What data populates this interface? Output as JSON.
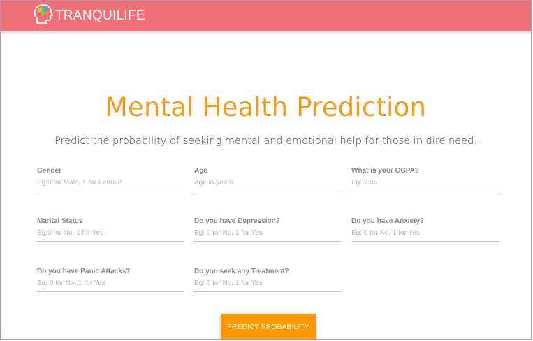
{
  "navbar": {
    "brand_name": "TRANQUILIFE",
    "brand_icon": "brain-head-icon",
    "background_color": "#f07077"
  },
  "main": {
    "title": "Mental Health Prediction",
    "subtitle": "Predict the probability of seeking mental and emotional help for those in dire need.",
    "title_color": "#f39a1a"
  },
  "form": {
    "fields": [
      {
        "label": "Gender",
        "placeholder": "Eg:0 for Male, 1 for Female",
        "value": ""
      },
      {
        "label": "Age",
        "placeholder": "Age in years",
        "value": ""
      },
      {
        "label": "What is your CGPA?",
        "placeholder": "Eg: 7.85",
        "value": ""
      },
      {
        "label": "Marital Status",
        "placeholder": "Eg:0 for No, 1 for Yes",
        "value": ""
      },
      {
        "label": "Do you have Depression?",
        "placeholder": "Eg: 0 for No, 1 for Yes",
        "value": ""
      },
      {
        "label": "Do you have Anxiety?",
        "placeholder": "Eg: 0 for No, 1 for Yes",
        "value": ""
      },
      {
        "label": "Do you have Panic Attacks?",
        "placeholder": "Eg: 0 for No, 1 for Yes",
        "value": ""
      },
      {
        "label": "Do you seek any Treatment?",
        "placeholder": "Eg: 0 for No, 1 for Yes",
        "value": ""
      }
    ],
    "submit_label": "PREDICT PROBABILITY",
    "submit_color": "#ff9800"
  }
}
